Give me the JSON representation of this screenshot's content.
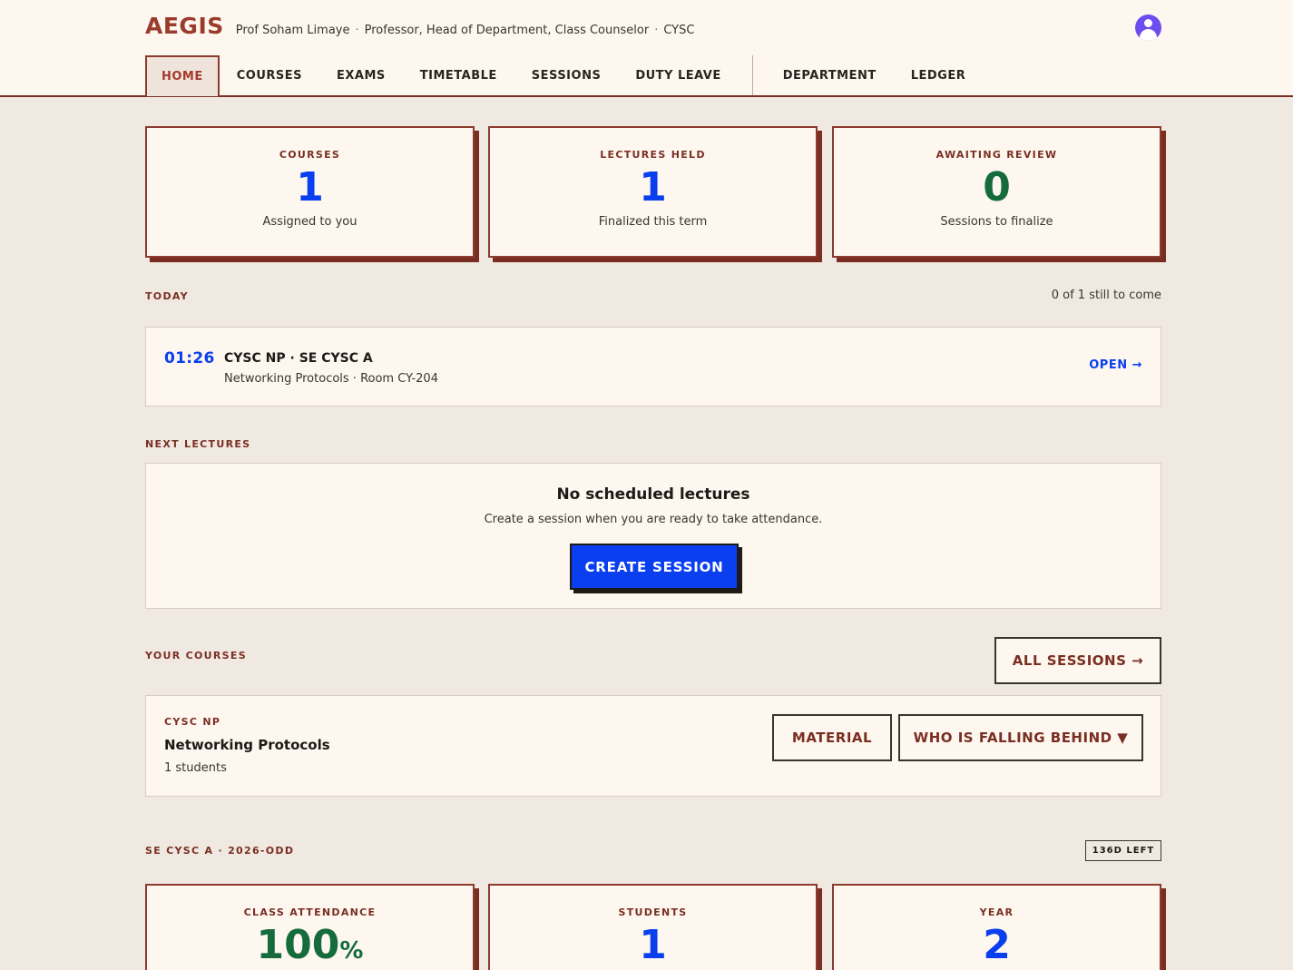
{
  "header": {
    "logo": "AEGIS",
    "user_name": "Prof Soham Limaye",
    "roles": "Professor, Head of Department, Class Counselor",
    "dept": "CYSC",
    "separator": "·"
  },
  "nav": {
    "tabs": [
      "HOME",
      "COURSES",
      "EXAMS",
      "TIMETABLE",
      "SESSIONS",
      "DUTY LEAVE"
    ],
    "extra_tabs": [
      "DEPARTMENT",
      "LEDGER"
    ],
    "active": "HOME"
  },
  "stats": [
    {
      "label": "COURSES",
      "value": "1",
      "sub": "Assigned to you",
      "color": "#0a3ff0"
    },
    {
      "label": "LECTURES HELD",
      "value": "1",
      "sub": "Finalized this term",
      "color": "#0a3ff0"
    },
    {
      "label": "AWAITING REVIEW",
      "value": "0",
      "sub": "Sessions to finalize",
      "color": "#156b3c"
    }
  ],
  "today": {
    "label": "TODAY",
    "summary": "0 of 1 still to come",
    "item": {
      "time": "01:26",
      "title": "CYSC NP · SE CYSC A",
      "meta": "Networking Protocols · Room CY-204",
      "action": "OPEN →"
    }
  },
  "next_lectures": {
    "label": "NEXT LECTURES",
    "empty_title": "No scheduled lectures",
    "empty_sub": "Create a session when you are ready to take attendance.",
    "create_button": "CREATE SESSION"
  },
  "your_courses": {
    "label": "YOUR COURSES",
    "all_sessions_button": "ALL SESSIONS →",
    "course": {
      "code": "CYSC NP",
      "name": "Networking Protocols",
      "students": "1 students",
      "material_button": "MATERIAL",
      "falling_button": "WHO IS FALLING BEHIND ▼"
    }
  },
  "class_section": {
    "label": "SE CYSC A · 2026-ODD",
    "badge": "136D LEFT",
    "stats": [
      {
        "label": "CLASS ATTENDANCE",
        "value": "100",
        "unit": "%",
        "color": "#156b3c"
      },
      {
        "label": "STUDENTS",
        "value": "1",
        "color": "#0a3ff0"
      },
      {
        "label": "YEAR",
        "value": "2",
        "color": "#0a3ff0"
      }
    ]
  },
  "colors": {
    "accent": "#7a2e22",
    "blue": "#0a3ff0",
    "green": "#156b3c",
    "background": "#f0e9e1",
    "card": "#fdf7ef"
  }
}
